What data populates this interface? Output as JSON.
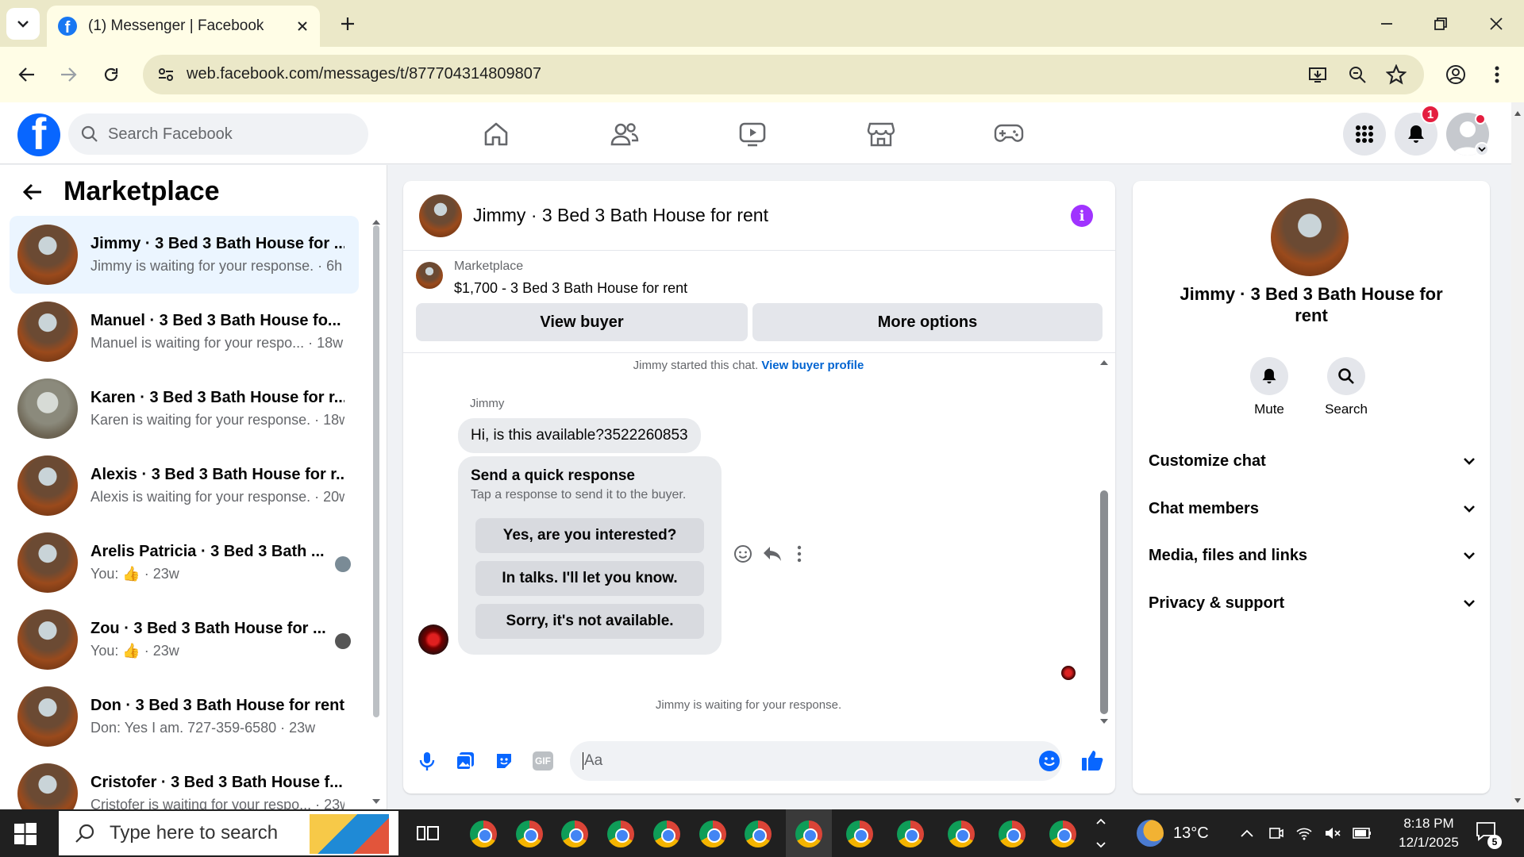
{
  "browser": {
    "tab_title": "(1) Messenger | Facebook",
    "url": "web.facebook.com/messages/t/877704314809807"
  },
  "fb": {
    "search_placeholder": "Search Facebook",
    "notification_count": "1"
  },
  "sidebar": {
    "title": "Marketplace",
    "conversations": [
      {
        "name": "Jimmy · 3 Bed 3 Bath House for ...",
        "preview": "Jimmy is waiting for your response. · 6h"
      },
      {
        "name": "Manuel · 3 Bed 3 Bath House fo...",
        "preview": "Manuel is waiting for your respo... · 18w"
      },
      {
        "name": "Karen · 3 Bed 3 Bath House for r...",
        "preview": "Karen is waiting for your response. · 18w"
      },
      {
        "name": "Alexis · 3 Bed 3 Bath House for r...",
        "preview": "Alexis is waiting for your response. · 20w"
      },
      {
        "name": "Arelis Patricia · 3 Bed 3 Bath ...",
        "preview": "You: 👍 · 23w"
      },
      {
        "name": "Zou · 3 Bed 3 Bath House for ...",
        "preview": "You: 👍 · 23w"
      },
      {
        "name": "Don · 3 Bed 3 Bath House for rent",
        "preview": "Don: Yes I am. 727-359-6580 · 23w"
      },
      {
        "name": "Cristofer · 3 Bed 3 Bath House f...",
        "preview": "Cristofer is waiting for your respo... · 23w"
      }
    ]
  },
  "chat": {
    "title": "Jimmy · 3 Bed 3 Bath House for rent",
    "listing_source": "Marketplace",
    "listing": "$1,700 - 3 Bed 3 Bath House for rent",
    "view_buyer": "View buyer",
    "more_options": "More options",
    "started_text": "Jimmy started this chat.",
    "view_buyer_profile": "View buyer profile",
    "sender": "Jimmy",
    "message": "Hi, is this available?3522260853",
    "quick_title": "Send a quick response",
    "quick_sub": "Tap a response to send it to the buyer.",
    "quick_1": "Yes, are you interested?",
    "quick_2": "In talks. I'll let you know.",
    "quick_3": "Sorry, it's not available.",
    "waiting": "Jimmy is waiting for your response.",
    "composer_placeholder": "Aa"
  },
  "details": {
    "name": "Jimmy · 3 Bed 3 Bath House for rent",
    "mute": "Mute",
    "search": "Search",
    "sections": [
      "Customize chat",
      "Chat members",
      "Media, files and links",
      "Privacy & support"
    ]
  },
  "taskbar": {
    "search_placeholder": "Type here to search",
    "temperature": "13°C",
    "time": "8:18 PM",
    "date": "12/1/2025",
    "notification_count": "5"
  },
  "colors": {
    "fb_blue": "#0866ff",
    "accent_purple": "#a033ff",
    "link_blue": "#0064d1"
  }
}
